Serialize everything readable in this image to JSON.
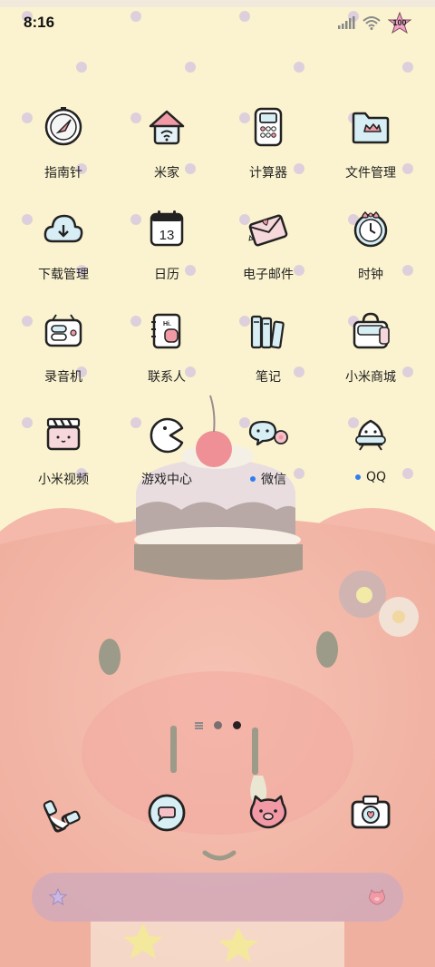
{
  "status_bar": {
    "time": "8:16",
    "battery_level": "100"
  },
  "apps": [
    {
      "label": "指南针",
      "icon": "compass-icon",
      "dot": false
    },
    {
      "label": "米家",
      "icon": "home-icon",
      "dot": false
    },
    {
      "label": "计算器",
      "icon": "calculator-icon",
      "dot": false
    },
    {
      "label": "文件管理",
      "icon": "folder-icon",
      "dot": false
    },
    {
      "label": "下载管理",
      "icon": "cloud-download-icon",
      "dot": false
    },
    {
      "label": "日历",
      "icon": "calendar-icon",
      "dot": false,
      "calendar_day": "13"
    },
    {
      "label": "电子邮件",
      "icon": "mail-icon",
      "dot": false
    },
    {
      "label": "时钟",
      "icon": "clock-icon",
      "dot": false
    },
    {
      "label": "录音机",
      "icon": "recorder-icon",
      "dot": false
    },
    {
      "label": "联系人",
      "icon": "contacts-icon",
      "dot": false,
      "contacts_text": "Hi."
    },
    {
      "label": "笔记",
      "icon": "notes-icon",
      "dot": false
    },
    {
      "label": "小米商城",
      "icon": "shopping-bag-icon",
      "dot": false
    },
    {
      "label": "小米视频",
      "icon": "video-clapper-icon",
      "dot": false
    },
    {
      "label": "游戏中心",
      "icon": "game-pacman-icon",
      "dot": false
    },
    {
      "label": "微信",
      "icon": "wechat-icon",
      "dot": true
    },
    {
      "label": "QQ",
      "icon": "qq-penguin-icon",
      "dot": true
    }
  ],
  "dock": [
    {
      "icon": "phone-icon"
    },
    {
      "icon": "messages-icon"
    },
    {
      "icon": "browser-pig-icon"
    },
    {
      "icon": "camera-icon"
    }
  ],
  "page_indicator": {
    "pages": 2,
    "active_index": 1
  },
  "colors": {
    "background": "#fbf3cf",
    "dot_pattern": "#ddd0dc",
    "plush": "#f3b8a8",
    "notification_dot": "#2f7ef0",
    "search_bar": "#cdaabe"
  }
}
